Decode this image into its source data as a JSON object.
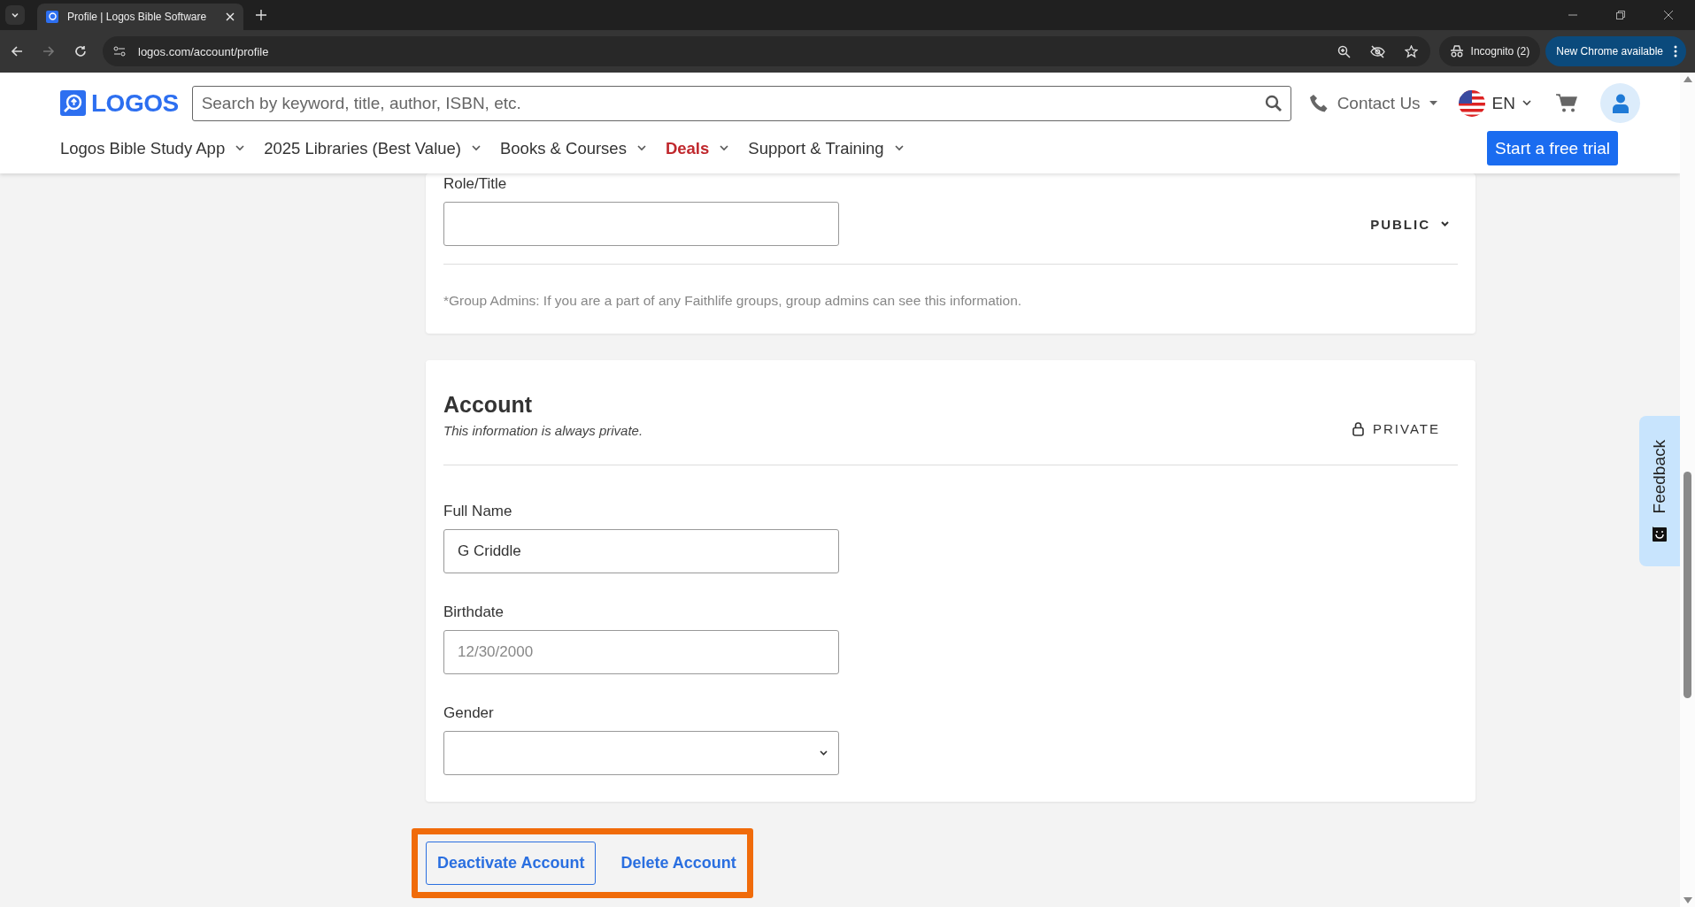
{
  "browser": {
    "tab_title": "Profile | Logos Bible Software",
    "url": "logos.com/account/profile",
    "incognito_label": "Incognito (2)",
    "update_label": "New Chrome available"
  },
  "site_header": {
    "logo_text": "LOGOS",
    "search": {
      "placeholder": "Search by keyword, title, author, ISBN, etc."
    },
    "contact": "Contact Us",
    "language": "EN",
    "nav": [
      {
        "label": "Logos Bible Study App",
        "highlighted": false
      },
      {
        "label": "2025 Libraries (Best Value)",
        "highlighted": false
      },
      {
        "label": "Books & Courses",
        "highlighted": false
      },
      {
        "label": "Deals",
        "highlighted": true
      },
      {
        "label": "Support & Training",
        "highlighted": false
      }
    ],
    "cta": "Start a free trial"
  },
  "profile_card": {
    "field_label": "Role/Title",
    "visibility": "PUBLIC",
    "note": "*Group Admins: If you are a part of any Faithlife groups, group admins can see this information."
  },
  "account_card": {
    "title": "Account",
    "subtitle": "This information is always private.",
    "visibility": "PRIVATE",
    "fields": [
      {
        "label": "Full Name",
        "kind": "text",
        "value": "G Criddle"
      },
      {
        "label": "Birthdate",
        "kind": "text",
        "placeholder": "12/30/2000"
      },
      {
        "label": "Gender",
        "kind": "select"
      }
    ]
  },
  "actions": [
    {
      "label": "Deactivate Account",
      "kind": "outline"
    },
    {
      "label": "Delete Account",
      "kind": "link"
    }
  ],
  "feedback": "Feedback"
}
